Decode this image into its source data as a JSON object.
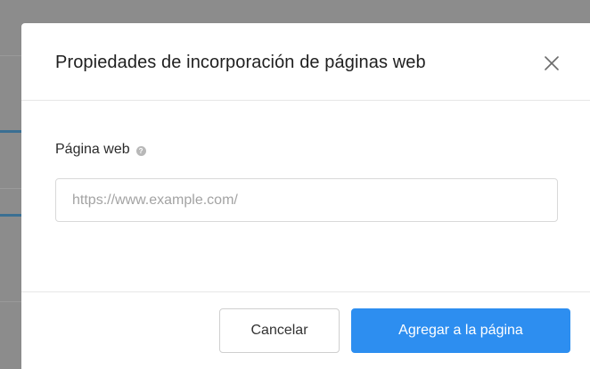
{
  "dialog": {
    "title": "Propiedades de incorporación de páginas web",
    "close_icon": "close-icon"
  },
  "form": {
    "label": "Página web",
    "help_icon": "help-icon",
    "help_glyph": "?",
    "input_value": "",
    "input_placeholder": "https://www.example.com/"
  },
  "footer": {
    "cancel_label": "Cancelar",
    "submit_label": "Agregar a la página"
  },
  "colors": {
    "primary": "#2d8ef0",
    "backdrop": "#8c8c8c"
  }
}
